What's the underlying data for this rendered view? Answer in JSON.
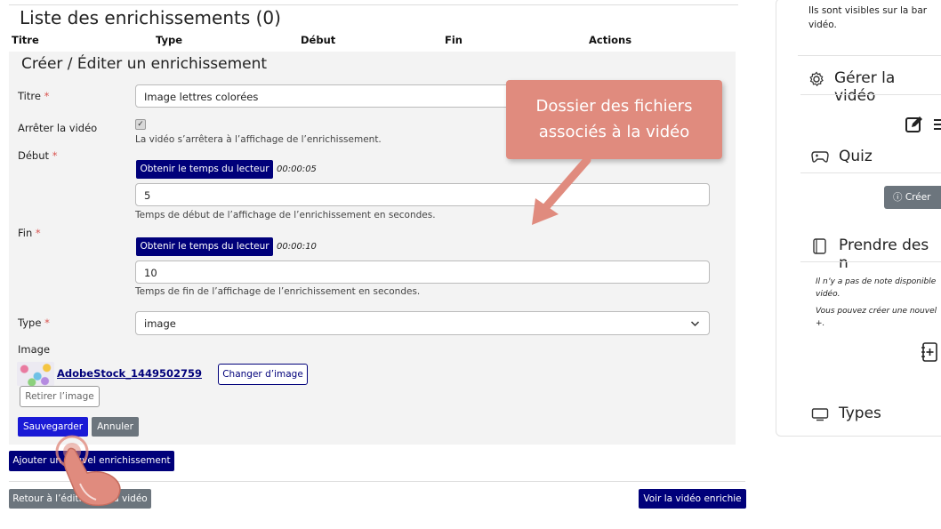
{
  "list": {
    "title": "Liste des enrichissements (0)",
    "columns": [
      "Titre",
      "Type",
      "Début",
      "Fin",
      "Actions"
    ]
  },
  "form": {
    "title": "Créer / Éditer un enrichissement",
    "required_mark": "*",
    "titre": {
      "label": "Titre",
      "value": "Image lettres colorées"
    },
    "stop_video": {
      "label": "Arrêter la vidéo",
      "checked": true,
      "help": "La vidéo s’arrêtera à l’affichage de l’enrichissement."
    },
    "debut": {
      "label": "Début",
      "button": "Obtenir le temps du lecteur",
      "time": "00:00:05",
      "value": "5",
      "help": "Temps de début de l’affichage de l’enrichissement en secondes."
    },
    "fin": {
      "label": "Fin",
      "button": "Obtenir le temps du lecteur",
      "time": "00:00:10",
      "value": "10",
      "help": "Temps de fin de l’affichage de l’enrichissement en secondes."
    },
    "type": {
      "label": "Type",
      "value": "image"
    },
    "image": {
      "label": "Image",
      "file": "AdobeStock_1449502759",
      "change_button": "Changer d’image",
      "remove_button": "Retirer l’image"
    },
    "save_button": "Sauvegarder",
    "cancel_button": "Annuler"
  },
  "actions": {
    "add_button": "Ajouter un nouvel enrichissement",
    "back_button": "Retour à l’édition de la vidéo",
    "view_button": "Voir la vidéo enrichie"
  },
  "callout": {
    "line1": "Dossier des fichiers",
    "line2": "associés à la vidéo"
  },
  "sidebar": {
    "intro_line1": "Ils sont visibles sur la bar",
    "intro_line2": "vidéo.",
    "manage_title": "Gérer la vidéo",
    "quiz_title": "Quiz",
    "quiz_button": "Créer",
    "notes_title": "Prendre des n",
    "notes_empty_line1": "Il n’y a pas de note disponible",
    "notes_empty_line2": "vidéo.",
    "notes_hint_line1": "Vous pouvez créer une nouvel",
    "notes_hint_line2": "+.",
    "types_title": "Types"
  },
  "colors": {
    "primary": "#00007a",
    "save": "#1a1ad6",
    "callout": "#e08b7e",
    "secondary": "#6c757d",
    "required": "#d9534f"
  }
}
